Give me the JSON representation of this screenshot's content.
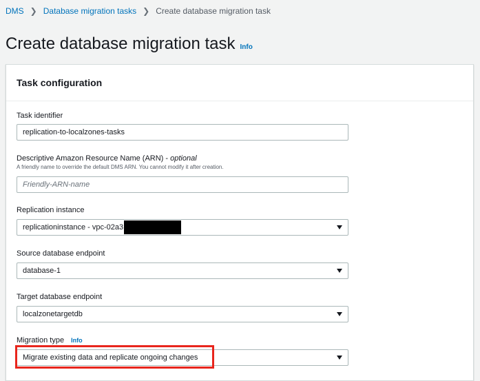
{
  "breadcrumb": {
    "items": [
      "DMS",
      "Database migration tasks"
    ],
    "current": "Create database migration task"
  },
  "page": {
    "title": "Create database migration task",
    "info": "Info"
  },
  "panel": {
    "title": "Task configuration"
  },
  "fields": {
    "task_identifier": {
      "label": "Task identifier",
      "value": "replication-to-localzones-tasks"
    },
    "arn": {
      "label": "Descriptive Amazon Resource Name (ARN) - ",
      "optional": "optional",
      "description": "A friendly name to override the default DMS ARN. You cannot modify it after creation.",
      "placeholder": "Friendly-ARN-name"
    },
    "replication_instance": {
      "label": "Replication instance",
      "value": "replicationinstance - vpc-02a3"
    },
    "source_endpoint": {
      "label": "Source database endpoint",
      "value": "database-1"
    },
    "target_endpoint": {
      "label": "Target database endpoint",
      "value": "localzonetargetdb"
    },
    "migration_type": {
      "label": "Migration type",
      "info": "Info",
      "value": "Migrate existing data and replicate ongoing changes"
    }
  },
  "colors": {
    "link": "#0073bb",
    "highlight": "#e8251c"
  }
}
